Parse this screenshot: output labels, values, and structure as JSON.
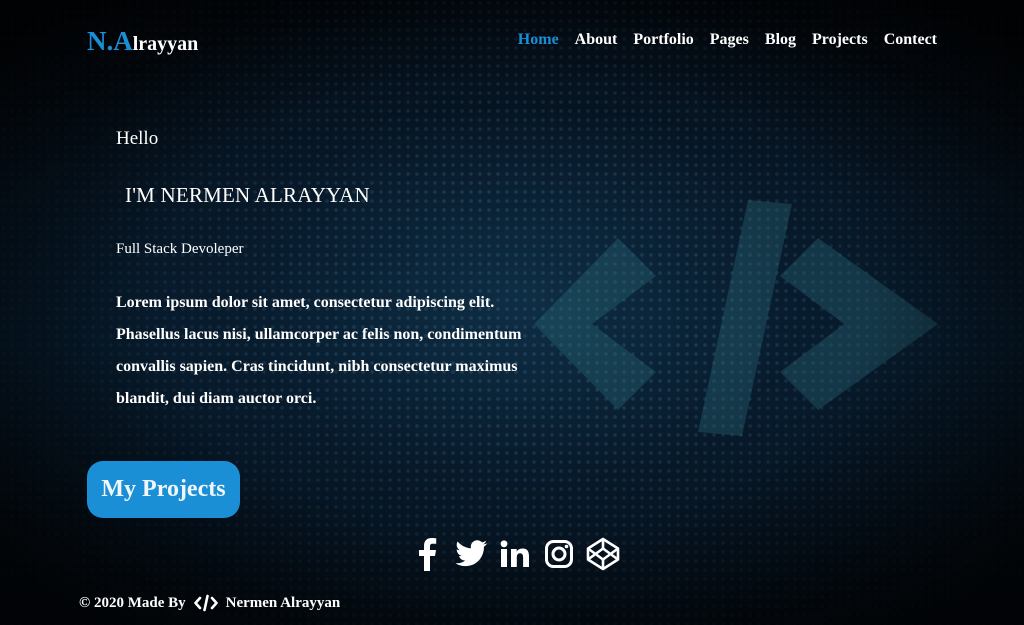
{
  "header": {
    "logo_accent": "N.A",
    "logo_rest": "lrayyan",
    "nav": [
      "Home",
      "About",
      "Portfolio",
      "Pages",
      "Blog",
      "Projects",
      "Contect"
    ],
    "active_nav": "Home"
  },
  "hero": {
    "greeting": "Hello",
    "name": "I'M NERMEN ALRAYYAN",
    "role": "Full Stack Devoleper",
    "description": "Lorem ipsum dolor sit amet, consectetur adipiscing elit. Phasellus lacus nisi, ullamcorper ac felis non, condimentum convallis sapien. Cras tincidunt, nibh consectetur maximus blandit, dui diam auctor orci.",
    "cta_label": "My Projects"
  },
  "social": {
    "icons": [
      "facebook-icon",
      "twitter-icon",
      "linkedin-icon",
      "instagram-icon",
      "codepen-icon"
    ]
  },
  "footer": {
    "prefix": "© 2020 Made By",
    "icon": "code-icon",
    "author": "Nermen Alrayyan"
  },
  "colors": {
    "accent": "#1a8fd6",
    "text": "#ffffff",
    "background": "#05090f"
  }
}
